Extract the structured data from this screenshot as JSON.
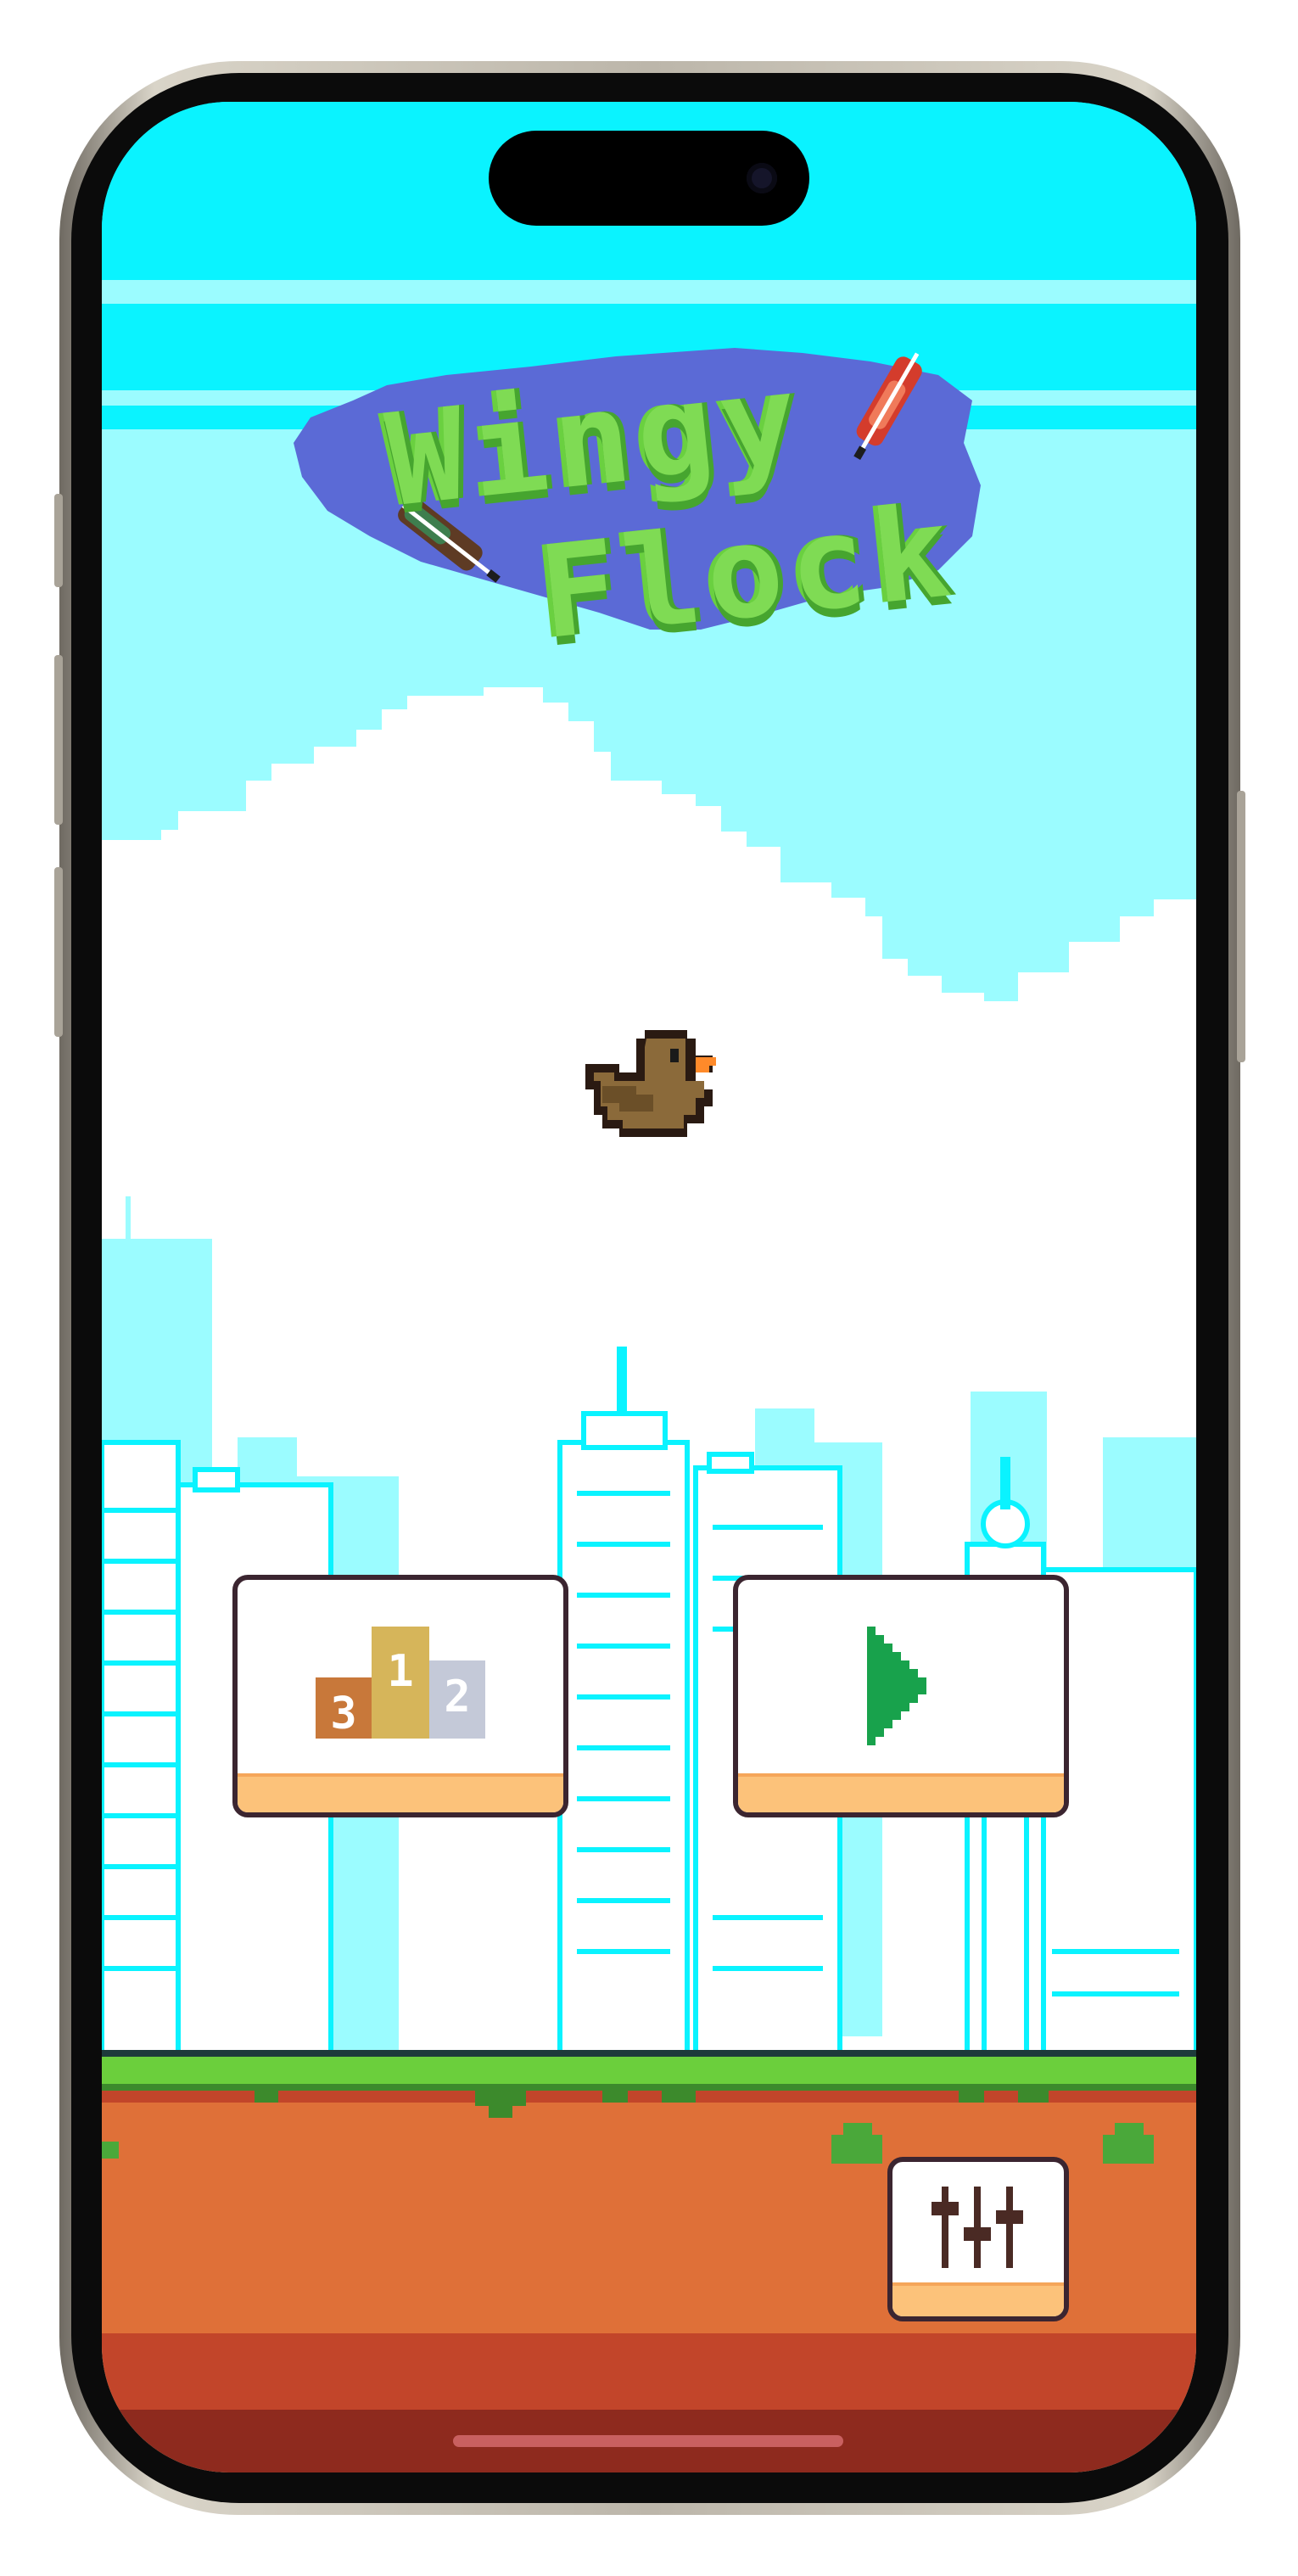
{
  "game": {
    "title_line1": "Wingy",
    "title_line2": "Flock"
  },
  "buttons": {
    "leaderboard": {
      "icon": "podium-icon",
      "places": [
        "3",
        "1",
        "2"
      ],
      "colors": [
        "#c8783a",
        "#d6b55a",
        "#c4c9d8"
      ]
    },
    "play": {
      "icon": "play-icon",
      "color": "#18a24c"
    },
    "settings": {
      "icon": "sliders-icon"
    }
  },
  "colors": {
    "sky_top": "#0af3ff",
    "sky": "#9bfcff",
    "cloud": "#ffffff",
    "grass": "#6bcf3c",
    "dirt": "#df7038",
    "dirt_dark": "#c2452a",
    "dirt_deep": "#8e2a1e",
    "button_border": "#3b2530",
    "button_shade": "#fcc27a",
    "bird": "#8b6a3a"
  }
}
